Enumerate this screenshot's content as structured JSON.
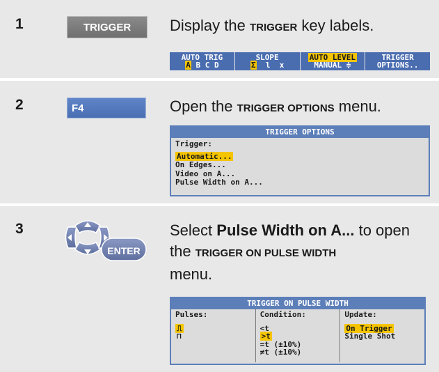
{
  "steps": [
    {
      "number": "1",
      "key_label": "TRIGGER",
      "instruction_pre": "Display the ",
      "instruction_bold": "TRIGGER",
      "instruction_post": " key labels.",
      "softkeys": [
        {
          "line1": "AUTO TRIG",
          "line2_items": [
            "A",
            "B",
            "C",
            "D"
          ],
          "line2_selected": "A"
        },
        {
          "line1": "SLOPE",
          "line2_items": [
            "Ʃ",
            "l",
            "x"
          ],
          "line2_selected": "Ʃ"
        },
        {
          "line1": "AUTO LEVEL",
          "line2": "MANUAL ≑"
        },
        {
          "line1": "TRIGGER",
          "line2": "OPTIONS.."
        }
      ]
    },
    {
      "number": "2",
      "key_label": "F4",
      "instruction_pre": "Open the ",
      "instruction_bold": "TRIGGER OPTIONS",
      "instruction_post": " menu.",
      "menu": {
        "title": "TRIGGER OPTIONS",
        "heading": "Trigger:",
        "items": [
          "Automatic...",
          "On Edges...",
          "Video on A...",
          "Pulse Width on A..."
        ],
        "selected": "Automatic..."
      }
    },
    {
      "number": "3",
      "key_label": "ENTER",
      "instruction_pre": "Select ",
      "instruction_bold": "Pulse Width on A...",
      "instruction_mid": " to open the ",
      "instruction_bold2": "TRIGGER ON PULSE WIDTH",
      "instruction_post": " menu.",
      "menu": {
        "title": "TRIGGER ON PULSE WIDTH",
        "columns": [
          {
            "header": "Pulses:",
            "items": [
              "⎍",
              "⊓"
            ],
            "selected": "⎍"
          },
          {
            "header": "Condition:",
            "items": [
              "<t",
              ">t",
              "=t (±10%)",
              "≠t (±10%)"
            ],
            "selected": ">t"
          },
          {
            "header": "Update:",
            "items": [
              "On Trigger",
              "Single Shot"
            ],
            "selected": "On Trigger"
          }
        ]
      }
    }
  ],
  "colors": {
    "panel": "#e8e8e8",
    "screen_blue": "#4a6db0",
    "highlight": "#f5c400",
    "f4_key": "#4a6fb3",
    "enter_key": "#6f7fab"
  }
}
